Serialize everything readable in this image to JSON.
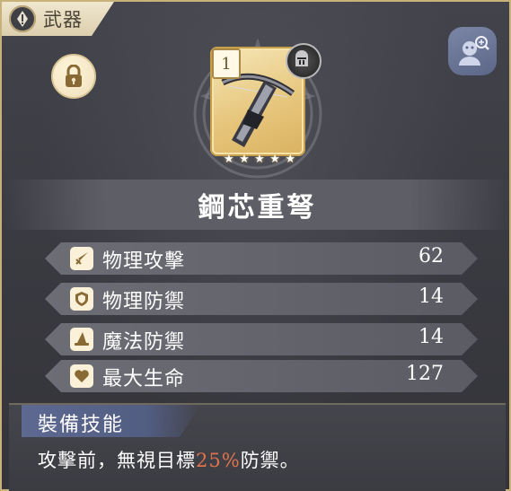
{
  "header": {
    "category_label": "武器",
    "category_icon": "info-exclamation-icon"
  },
  "controls": {
    "lock_icon": "lock-icon",
    "inspect_icon": "character-magnify-icon"
  },
  "item": {
    "level": "1",
    "name": "鋼芯重弩",
    "stars": 5,
    "art": "crossbow-weapon",
    "badge_icon": "knight-helmet-icon",
    "rarity_color": "#e8c77c"
  },
  "stats": [
    {
      "icon": "sword-icon",
      "label": "物理攻擊",
      "value": "62"
    },
    {
      "icon": "shield-icon",
      "label": "物理防禦",
      "value": "14"
    },
    {
      "icon": "wizard-hat-icon",
      "label": "魔法防禦",
      "value": "14"
    },
    {
      "icon": "heart-icon",
      "label": "最大生命",
      "value": "127"
    }
  ],
  "skill": {
    "title": "裝備技能",
    "desc_before": "攻擊前，無視目標",
    "desc_highlight": "25%",
    "desc_after": "防禦。",
    "highlight_color": "#e0734d"
  }
}
